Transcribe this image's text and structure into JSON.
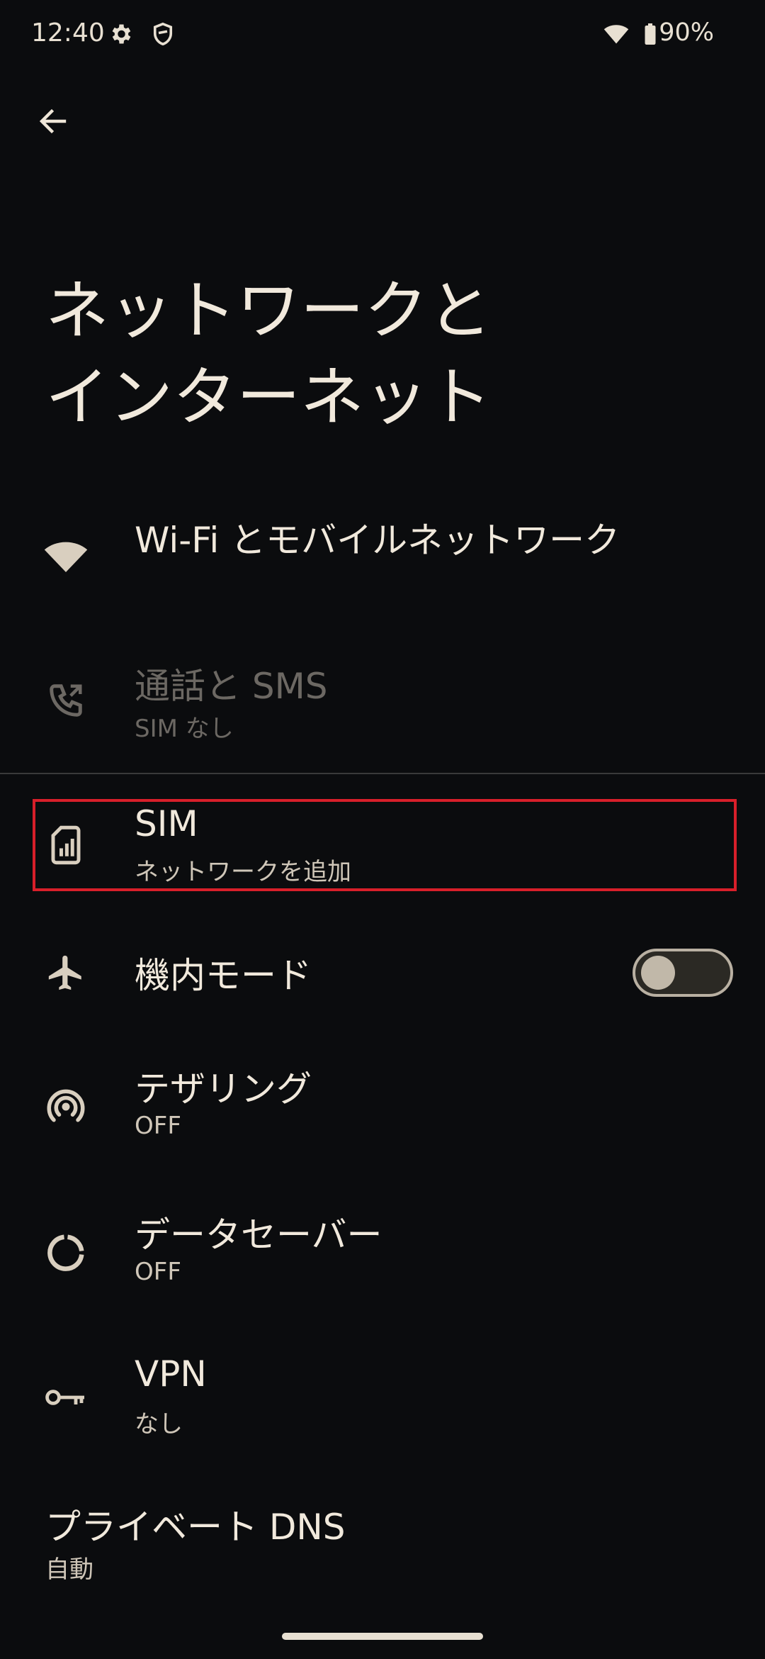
{
  "status_bar": {
    "time": "12:40",
    "battery": "90%",
    "icons": [
      "gear-icon",
      "shield-icon",
      "wifi-icon",
      "battery-icon"
    ]
  },
  "header": {
    "back_icon": "arrow-left-icon",
    "title_line1": "ネットワークと",
    "title_line2": "インターネット"
  },
  "items": [
    {
      "icon": "wifi-icon",
      "title": "Wi-Fi とモバイルネットワーク",
      "subtitle": ""
    },
    {
      "icon": "phone-call-icon",
      "title": "通話と SMS",
      "subtitle": "SIM なし",
      "disabled": true
    },
    {
      "icon": "sim-card-icon",
      "title": "SIM",
      "subtitle": "ネットワークを追加",
      "highlighted": true
    },
    {
      "icon": "airplane-icon",
      "title": "機内モード",
      "subtitle": "",
      "toggle": false
    },
    {
      "icon": "hotspot-icon",
      "title": "テザリング",
      "subtitle": "OFF"
    },
    {
      "icon": "data-saver-icon",
      "title": "データセーバー",
      "subtitle": "OFF"
    },
    {
      "icon": "key-icon",
      "title": "VPN",
      "subtitle": "なし"
    }
  ],
  "private_dns": {
    "title": "プライベート DNS",
    "subtitle": "自動"
  },
  "colors": {
    "background": "#0b0c0e",
    "text": "#f1e9dc",
    "highlight": "#d81f2a"
  }
}
